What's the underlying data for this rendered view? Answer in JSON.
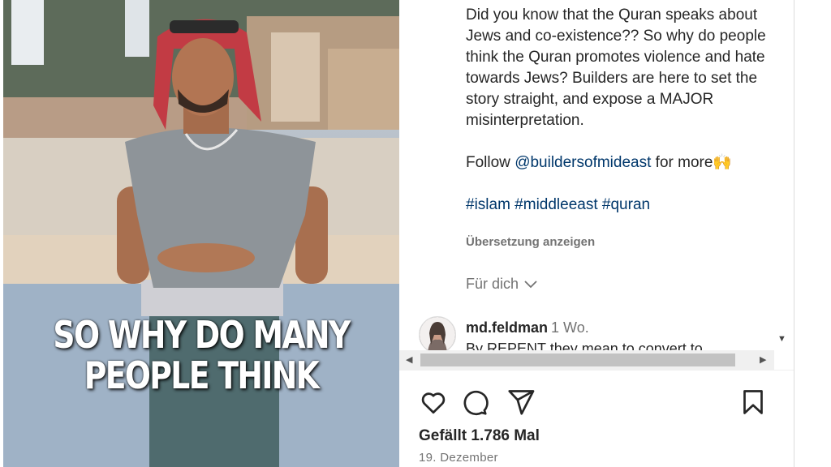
{
  "video": {
    "overlay_line1": "SO WHY DO MANY",
    "overlay_line2": "PEOPLE THINK"
  },
  "caption": {
    "text": "Did you know that the Quran speaks about Jews and co-existence?? So why do people think the Quran promotes violence and hate towards Jews? Builders are here to set the story straight, and expose a MAJOR misinterpretation.",
    "follow_prefix": "Follow ",
    "follow_handle": "@buildersofmideast",
    "follow_suffix": " for more🙌",
    "hashtags": "#islam #middleeast #quran",
    "translate": "Übersetzung anzeigen"
  },
  "for_you": {
    "label": "Für dich"
  },
  "comment": {
    "username": "md.feldman",
    "time": "1 Wo.",
    "text": "By REPENT they mean to convert to"
  },
  "actions": {
    "like_icon": "heart-icon",
    "comment_icon": "comment-icon",
    "share_icon": "share-icon",
    "save_icon": "bookmark-icon"
  },
  "likes": {
    "label": "Gefällt 1.786 Mal"
  },
  "post_date": {
    "label": "19. Dezember"
  },
  "colors": {
    "link": "#00376b",
    "muted": "#737373",
    "text": "#262626"
  }
}
